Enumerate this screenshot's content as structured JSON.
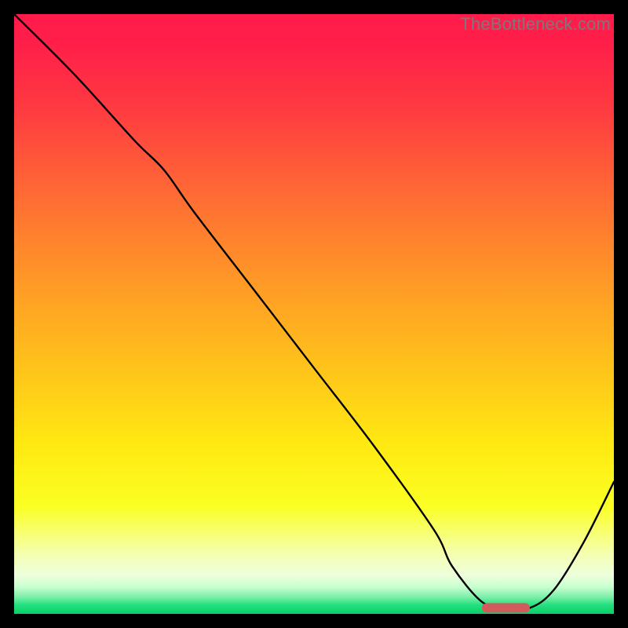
{
  "watermark": "TheBottleneck.com",
  "chart_data": {
    "type": "line",
    "title": "",
    "xlabel": "",
    "ylabel": "",
    "xlim": [
      0,
      100
    ],
    "ylim": [
      0,
      100
    ],
    "grid": false,
    "legend": false,
    "series": [
      {
        "name": "bottleneck-curve",
        "x": [
          0,
          10,
          20,
          25,
          30,
          40,
          50,
          60,
          70,
          73,
          78,
          82,
          86,
          90,
          95,
          100
        ],
        "y": [
          100,
          90,
          79,
          74,
          67,
          54,
          41,
          28,
          14,
          8,
          2,
          1,
          1,
          4,
          12,
          22
        ]
      }
    ],
    "marker": {
      "name": "optimal-range",
      "x_start": 78,
      "x_end": 86,
      "y": 1,
      "color": "#d15a5a"
    },
    "gradient_stops": [
      {
        "pos": 0.0,
        "color": "#ff1b4b"
      },
      {
        "pos": 0.05,
        "color": "#ff1f49"
      },
      {
        "pos": 0.15,
        "color": "#ff3842"
      },
      {
        "pos": 0.3,
        "color": "#ff6a34"
      },
      {
        "pos": 0.45,
        "color": "#ff9a26"
      },
      {
        "pos": 0.6,
        "color": "#ffc61a"
      },
      {
        "pos": 0.72,
        "color": "#ffea12"
      },
      {
        "pos": 0.82,
        "color": "#fbff23"
      },
      {
        "pos": 0.9,
        "color": "#f4ffb0"
      },
      {
        "pos": 0.935,
        "color": "#eeffdc"
      },
      {
        "pos": 0.955,
        "color": "#c8ffd0"
      },
      {
        "pos": 0.972,
        "color": "#7af0a8"
      },
      {
        "pos": 0.985,
        "color": "#24e07e"
      },
      {
        "pos": 1.0,
        "color": "#08cf6a"
      }
    ]
  }
}
